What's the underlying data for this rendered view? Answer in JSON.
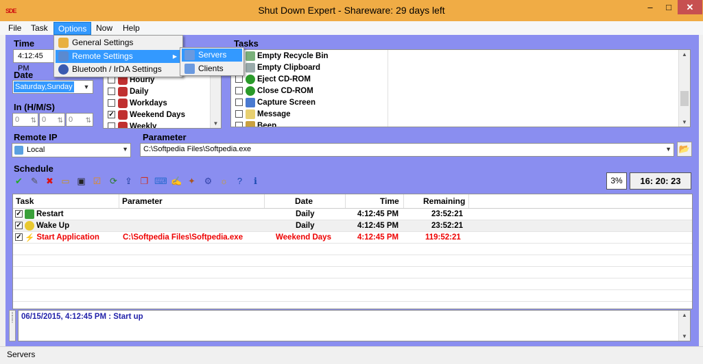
{
  "window": {
    "title": "Shut Down Expert - Shareware:  29 days left",
    "app_icon_text": "SDE",
    "min": "–",
    "max": "□",
    "close": "✕"
  },
  "menubar": [
    "File",
    "Task",
    "Options",
    "Now",
    "Help"
  ],
  "options_menu": [
    {
      "label": "General Settings",
      "icon": "gear-hand-icon"
    },
    {
      "label": "Remote Settings",
      "icon": "network-icon",
      "arrow": "▶"
    },
    {
      "label": "Bluetooth / IrDA Settings",
      "icon": "bluetooth-icon"
    }
  ],
  "remote_submenu": [
    {
      "label": "Servers",
      "icon": "server-icon"
    },
    {
      "label": "Clients",
      "icon": "client-icon"
    }
  ],
  "time_group": {
    "label": "Time",
    "value": "4:12:45 PM"
  },
  "date_group": {
    "label": "Date",
    "value": "Saturday,Sunday"
  },
  "in_group": {
    "label": "In (H/M/S)",
    "h": "0",
    "m": "0",
    "s": "0"
  },
  "days_list": [
    {
      "label": "Hourly",
      "checked": false
    },
    {
      "label": "Daily",
      "checked": false
    },
    {
      "label": "Workdays",
      "checked": false
    },
    {
      "label": "Weekend Days",
      "checked": true
    },
    {
      "label": "Weekly",
      "checked": false
    }
  ],
  "tasks_group": {
    "label": "Tasks",
    "items": [
      {
        "label": "Empty Recycle Bin",
        "checked": false
      },
      {
        "label": "Empty Clipboard",
        "checked": false
      },
      {
        "label": "Eject CD-ROM",
        "checked": false
      },
      {
        "label": "Close CD-ROM",
        "checked": false
      },
      {
        "label": "Capture Screen",
        "checked": false
      },
      {
        "label": "Message",
        "checked": false
      },
      {
        "label": "Beep",
        "checked": false
      }
    ]
  },
  "remote_ip": {
    "label": "Remote IP",
    "value": "Local"
  },
  "parameter": {
    "label": "Parameter",
    "value": "C:\\Softpedia Files\\Softpedia.exe"
  },
  "schedule": {
    "label": "Schedule",
    "percent": "3%",
    "clock": "16: 20: 23",
    "columns": [
      "Task",
      "Parameter",
      "Date",
      "Time",
      "Remaining"
    ],
    "rows": [
      {
        "task": "Restart",
        "parameter": "",
        "date": "Daily",
        "time": "4:12:45 PM",
        "remaining": "23:52:21",
        "checked": true,
        "highlight": false
      },
      {
        "task": "Wake Up",
        "parameter": "",
        "date": "Daily",
        "time": "4:12:45 PM",
        "remaining": "23:52:21",
        "checked": true,
        "highlight": false
      },
      {
        "task": "Start Application",
        "parameter": "C:\\Softpedia Files\\Softpedia.exe",
        "date": "Weekend Days",
        "time": "4:12:45 PM",
        "remaining": "119:52:21",
        "checked": true,
        "highlight": true
      }
    ]
  },
  "log": {
    "entry": "06/15/2015, 4:12:45 PM : Start up"
  },
  "statusbar": {
    "text": "Servers"
  },
  "colors": {
    "accent": "#3399ff",
    "purple": "#8a8ef0",
    "highlight_row": "#ee0000",
    "log_text": "#2222aa",
    "title_bar": "#f0ac45"
  }
}
